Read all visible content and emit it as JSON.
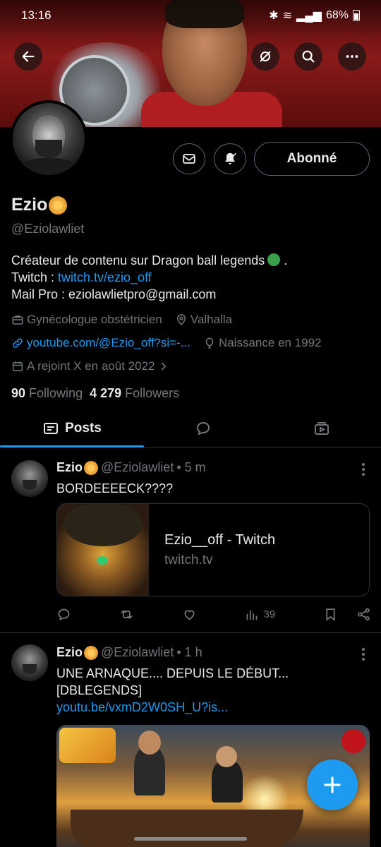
{
  "status_bar": {
    "time": "13:16",
    "battery": "68%"
  },
  "profile": {
    "name": "Ezio",
    "handle": "@Eziolawliet",
    "follow_button": "Abonné",
    "bio": {
      "line1": "Créateur de contenu sur Dragon ball legends",
      "line1_end": ".",
      "twitch_prefix": "Twitch : ",
      "twitch_link": "twitch.tv/ezio_off",
      "mail": "Mail Pro : eziolawlietpro@gmail.com"
    },
    "profession": "Gynécologue obstétricien",
    "location": "Valhalla",
    "website": "youtube.com/@Ezio_off?si=-...",
    "birth": "Naissance en 1992",
    "joined": "A rejoint X en août 2022",
    "following_count": "90",
    "following_label": "Following",
    "followers_count": "4 279",
    "followers_label": "Followers"
  },
  "tabs": {
    "posts": "Posts"
  },
  "posts": [
    {
      "name": "Ezio",
      "handle": "@Eziolawliet",
      "time": "• 5 m",
      "text": "BORDEEEECK????",
      "card": {
        "title": "Ezio__off - Twitch",
        "domain": "twitch.tv"
      },
      "views": "39"
    },
    {
      "name": "Ezio",
      "handle": "@Eziolawliet",
      "time": "• 1 h",
      "text_line1": "UNE ARNAQUE.... DEPUIS LE DÉBUT...",
      "text_line2": "[DBLEGENDS]",
      "link": "youtu.be/vxmD2W0SH_U?is..."
    }
  ],
  "colors": {
    "accent": "#1d9bf0",
    "muted": "#71767b",
    "border": "#2f3336"
  }
}
